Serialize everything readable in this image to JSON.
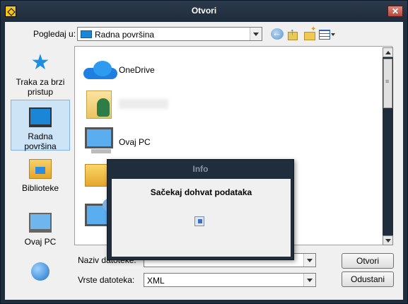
{
  "window": {
    "title": "Otvori",
    "close_label": "✕"
  },
  "toolbar": {
    "look_in_label": "Pogledaj u:",
    "look_in_value": "Radna površina"
  },
  "places": [
    {
      "label": "Traka za brzi pristup",
      "icon": "star-icon"
    },
    {
      "label": "Radna površina",
      "icon": "desktop-icon",
      "selected": true
    },
    {
      "label": "Biblioteke",
      "icon": "libraries-icon"
    },
    {
      "label": "Ovaj PC",
      "icon": "this-pc-icon"
    },
    {
      "label": "",
      "icon": "network-icon"
    }
  ],
  "files": [
    {
      "label": "OneDrive",
      "icon": "onedrive-icon"
    },
    {
      "label": "",
      "icon": "user-folder-icon"
    },
    {
      "label": "Ovaj PC",
      "icon": "computer-icon"
    },
    {
      "label": "",
      "icon": "folder-icon"
    },
    {
      "label": "",
      "icon": "network-computer-icon"
    }
  ],
  "form": {
    "name_label": "Naziv datoteke:",
    "name_value": "",
    "type_label": "Vrste datoteka:",
    "type_value": "XML",
    "open_label": "Otvori",
    "cancel_label": "Odustani"
  },
  "info": {
    "title": "Info",
    "message": "Sačekaj dohvat podataka"
  }
}
